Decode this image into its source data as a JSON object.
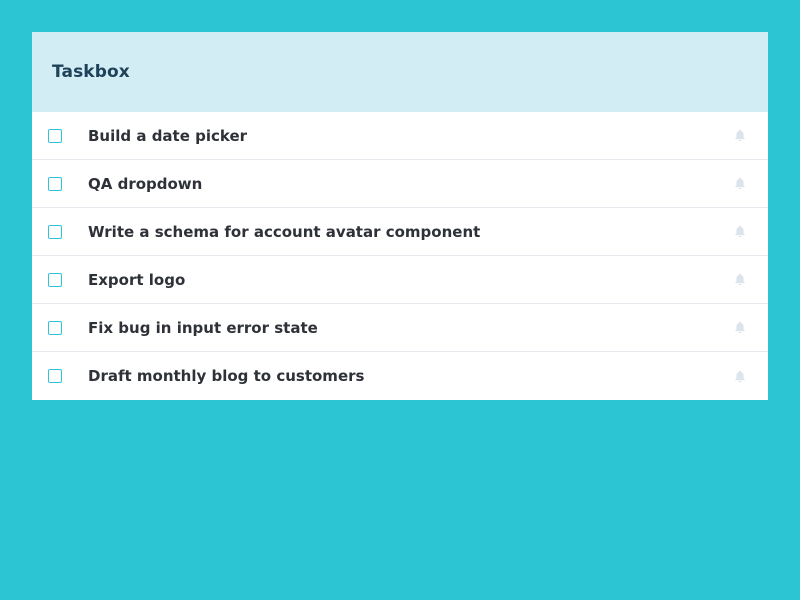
{
  "colors": {
    "background": "#2bc5d3",
    "header_bg": "#d3edf4",
    "title_text": "#1e4259",
    "task_text": "#2e3238",
    "checkbox_border": "#2bc5d3",
    "bell_icon": "#dde5ec"
  },
  "header": {
    "title": "Taskbox"
  },
  "tasks": [
    {
      "title": "Build a date picker",
      "checked": false,
      "icon": "bell-icon"
    },
    {
      "title": "QA dropdown",
      "checked": false,
      "icon": "bell-icon"
    },
    {
      "title": "Write a schema for account avatar component",
      "checked": false,
      "icon": "bell-icon"
    },
    {
      "title": "Export logo",
      "checked": false,
      "icon": "bell-icon"
    },
    {
      "title": "Fix bug in input error state",
      "checked": false,
      "icon": "bell-icon"
    },
    {
      "title": "Draft monthly blog to customers",
      "checked": false,
      "icon": "bell-icon"
    }
  ]
}
